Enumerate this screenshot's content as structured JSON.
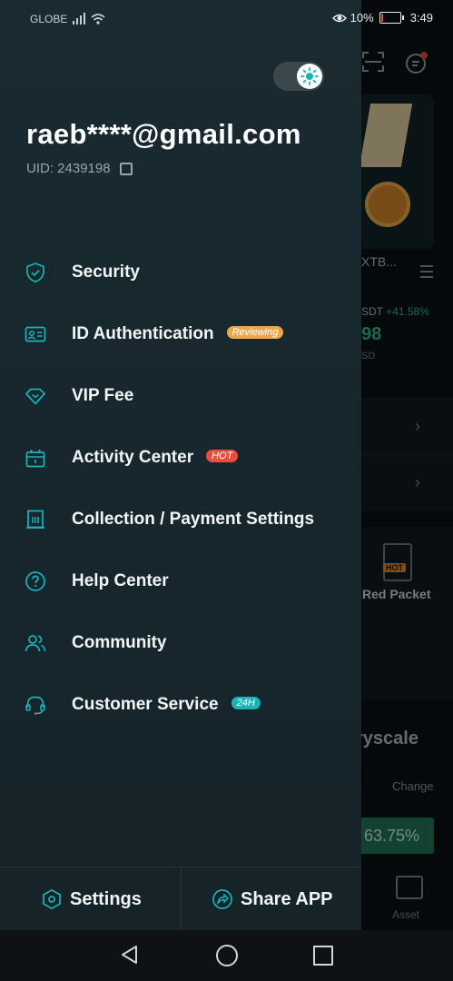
{
  "status_bar": {
    "carrier": "GLOBE",
    "battery_percent": "10%",
    "time": "3:49",
    "icons": [
      "signal-icon",
      "wifi-icon",
      "eye-icon",
      "battery-icon"
    ]
  },
  "background_app": {
    "ticker_label": "XTB...",
    "pair_label": "SDT",
    "pair_change": "+41.58%",
    "price": "98",
    "price_unit": "SD",
    "red_packet_badge": "HOT",
    "red_packet_label": "Red Packet",
    "greyscale_title": "ryscale",
    "change_label": "Change",
    "change_value": "63.75%",
    "asset_label": "Asset"
  },
  "drawer": {
    "theme_toggle": {
      "state": "light",
      "icon": "sun-icon"
    },
    "email": "raeb****@gmail.com",
    "uid": "UID: 2439198",
    "menu": [
      {
        "label": "Security",
        "icon": "shield-check-icon",
        "badge": null
      },
      {
        "label": "ID Authentication",
        "icon": "id-card-icon",
        "badge": "Reviewing"
      },
      {
        "label": "VIP Fee",
        "icon": "diamond-icon",
        "badge": null
      },
      {
        "label": "Activity Center",
        "icon": "gift-box-icon",
        "badge": "HOT"
      },
      {
        "label": "Collection / Payment Settings",
        "icon": "receipt-icon",
        "badge": null
      },
      {
        "label": "Help Center",
        "icon": "question-circle-icon",
        "badge": null
      },
      {
        "label": "Community",
        "icon": "users-icon",
        "badge": null
      },
      {
        "label": "Customer Service",
        "icon": "headset-icon",
        "badge": "24H"
      }
    ],
    "bottom": {
      "settings_label": "Settings",
      "share_label": "Share APP"
    }
  },
  "colors": {
    "drawer_bg": "#1a2a31",
    "accent_teal": "#1ab3b8",
    "reviewing_badge": "#eaa84a",
    "hot_badge": "#e74f3a",
    "positive_green": "#2ebf87"
  }
}
